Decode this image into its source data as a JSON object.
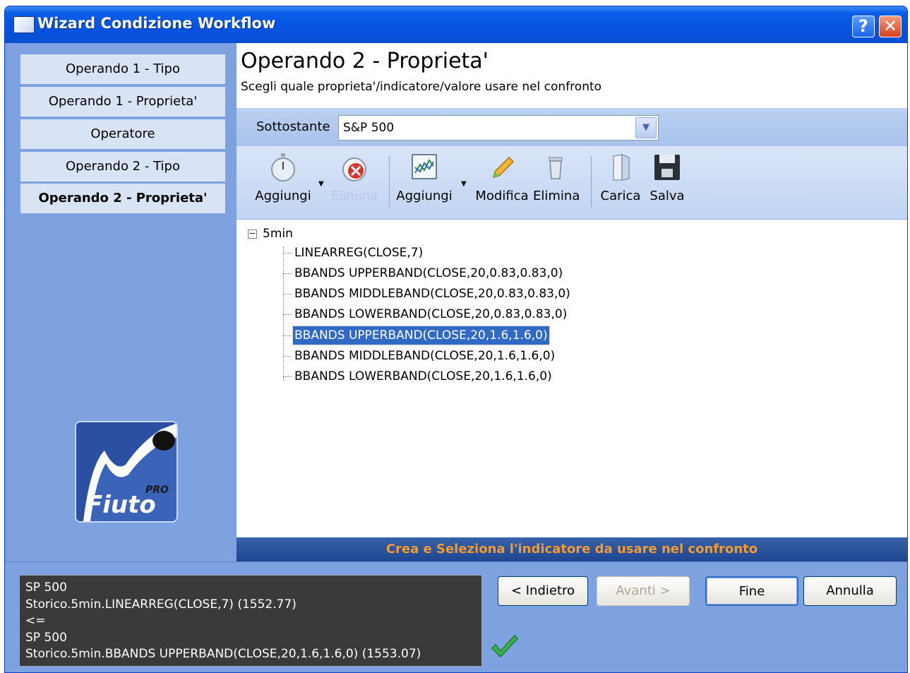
{
  "window": {
    "title": "Wizard Condizione Workflow"
  },
  "sidebar": {
    "steps": [
      {
        "label": "Operando 1 - Tipo"
      },
      {
        "label": "Operando 1 - Proprieta'"
      },
      {
        "label": "Operatore"
      },
      {
        "label": "Operando 2 - Tipo"
      },
      {
        "label": "Operando 2 - Proprieta'",
        "active": true
      }
    ],
    "logo": {
      "text": "Fiuto",
      "badge": "PRO"
    }
  },
  "header": {
    "title": "Operando 2 - Proprieta'",
    "subtitle": "Scegli quale proprieta'/indicatore/valore usare nel confronto"
  },
  "filter": {
    "label": "Sottostante",
    "value": "S&P 500"
  },
  "toolbar": {
    "add_timeframe": "Aggiungi",
    "delete_timeframe": "Elimina",
    "add_indicator": "Aggiungi",
    "edit": "Modifica",
    "delete": "Elimina",
    "load": "Carica",
    "save": "Salva"
  },
  "tree": {
    "root": "5min",
    "items": [
      {
        "label": "LINEARREG(CLOSE,7)"
      },
      {
        "label": "BBANDS UPPERBAND(CLOSE,20,0.83,0.83,0)"
      },
      {
        "label": "BBANDS MIDDLEBAND(CLOSE,20,0.83,0.83,0)"
      },
      {
        "label": "BBANDS LOWERBAND(CLOSE,20,0.83,0.83,0)"
      },
      {
        "label": "BBANDS UPPERBAND(CLOSE,20,1.6,1.6,0)",
        "selected": true
      },
      {
        "label": "BBANDS MIDDLEBAND(CLOSE,20,1.6,1.6,0)"
      },
      {
        "label": "BBANDS LOWERBAND(CLOSE,20,1.6,1.6,0)"
      }
    ]
  },
  "hint": "Crea e Seleziona l'indicatore da usare nel confronto",
  "summary": {
    "lines": [
      "SP 500",
      "Storico.5min.LINEARREG(CLOSE,7) (1552.77)",
      "<=",
      "SP 500",
      "Storico.5min.BBANDS UPPERBAND(CLOSE,20,1.6,1.6,0) (1553.07)"
    ]
  },
  "buttons": {
    "back": "< Indietro",
    "next": "Avanti >",
    "finish": "Fine",
    "cancel": "Annulla"
  },
  "colors": {
    "title_bar": "#0553e0",
    "panel": "#7ea2df",
    "selection": "#316ac5",
    "hint_text": "#f39a32"
  }
}
